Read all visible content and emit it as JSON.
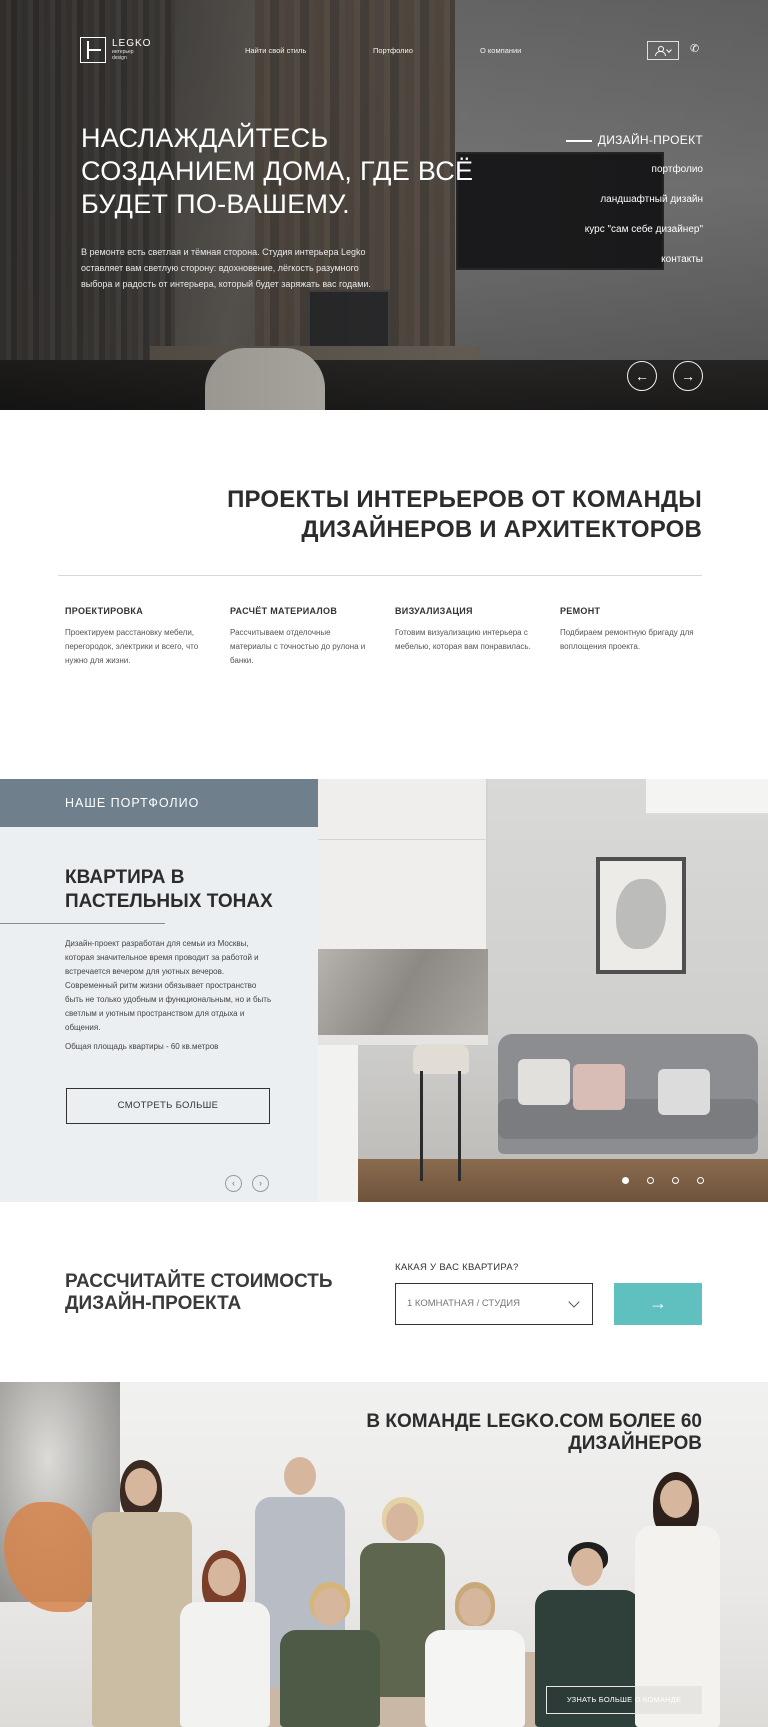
{
  "logo": {
    "name": "LEGKO",
    "tagline_1": "интерьер",
    "tagline_2": "design"
  },
  "nav": {
    "style": "Найти свой стиль",
    "portfolio": "Портфолио",
    "about": "О компании"
  },
  "icons": {
    "user": "user-icon",
    "dropdown": "chevron-down-icon",
    "phone": "phone-icon",
    "prev": "arrow-left-icon",
    "next": "arrow-right-icon"
  },
  "hero": {
    "title": "Наслаждайтесь созданием дома, где всё будет по-вашему.",
    "text": "В ремонте есть светлая и тёмная сторона. Студия интерьера Legko оставляет вам светлую сторону: вдохновение, лёгкость разумного выбора и радость от интерьера, который будет заряжать вас годами.",
    "side_menu": [
      "ДИЗАЙН-ПРОЕКТ",
      "портфолио",
      "ландшафтный дизайн",
      "курс \"сам себе дизайнер\"",
      "контакты"
    ],
    "prev_glyph": "←",
    "next_glyph": "→"
  },
  "projects": {
    "title": "Проекты интерьеров от команды дизайнеров и архитекторов",
    "services": [
      {
        "heading": "ПРОЕКТИРОВКА",
        "text": "Проектируем расстановку мебели, перегородок, электрики и всего, что нужно для жизни."
      },
      {
        "heading": "РАСЧЁТ МАТЕРИАЛОВ",
        "text": "Рассчитываем отделочные материалы с точностью до рулона и банки."
      },
      {
        "heading": "ВИЗУАЛИЗАЦИЯ",
        "text": "Готовим визуализацию интерьера с мебелью, которая вам понравилась."
      },
      {
        "heading": "РЕМОНТ",
        "text": "Подбираем ремонтную бригаду для воплощения проекта."
      }
    ]
  },
  "portfolio": {
    "bar": "НАШЕ ПОРТФОЛИО",
    "title": "Квартира в пастельных тонах",
    "text": "Дизайн-проект разработан для семьи из Москвы, которая значительное время проводит за работой и встречается вечером для уютных вечеров. Современный ритм жизни обязывает пространство быть не только удобным и функциональным, но и быть светлым и уютным пространством для отдыха и общения.",
    "area": "Общая площадь квартиры - 60 кв.метров",
    "more": "СМОТРЕТЬ БОЛЬШЕ",
    "slides_total": 4,
    "slide_active": 1,
    "prev_glyph": "‹",
    "next_glyph": "›"
  },
  "calc": {
    "title": "Рассчитайте стоимость дизайн-проекта",
    "label": "КАКАЯ У ВАС КВАРТИРА?",
    "select_value": "1 КОМНАТНАЯ / СТУДИЯ",
    "go_glyph": "→",
    "accent": "#5fc0bf"
  },
  "team": {
    "title": "В команде LEGKO.COM более 60 дизайнеров",
    "button": "УЗНАТЬ БОЛЬШЕ О КОМАНДЕ"
  }
}
